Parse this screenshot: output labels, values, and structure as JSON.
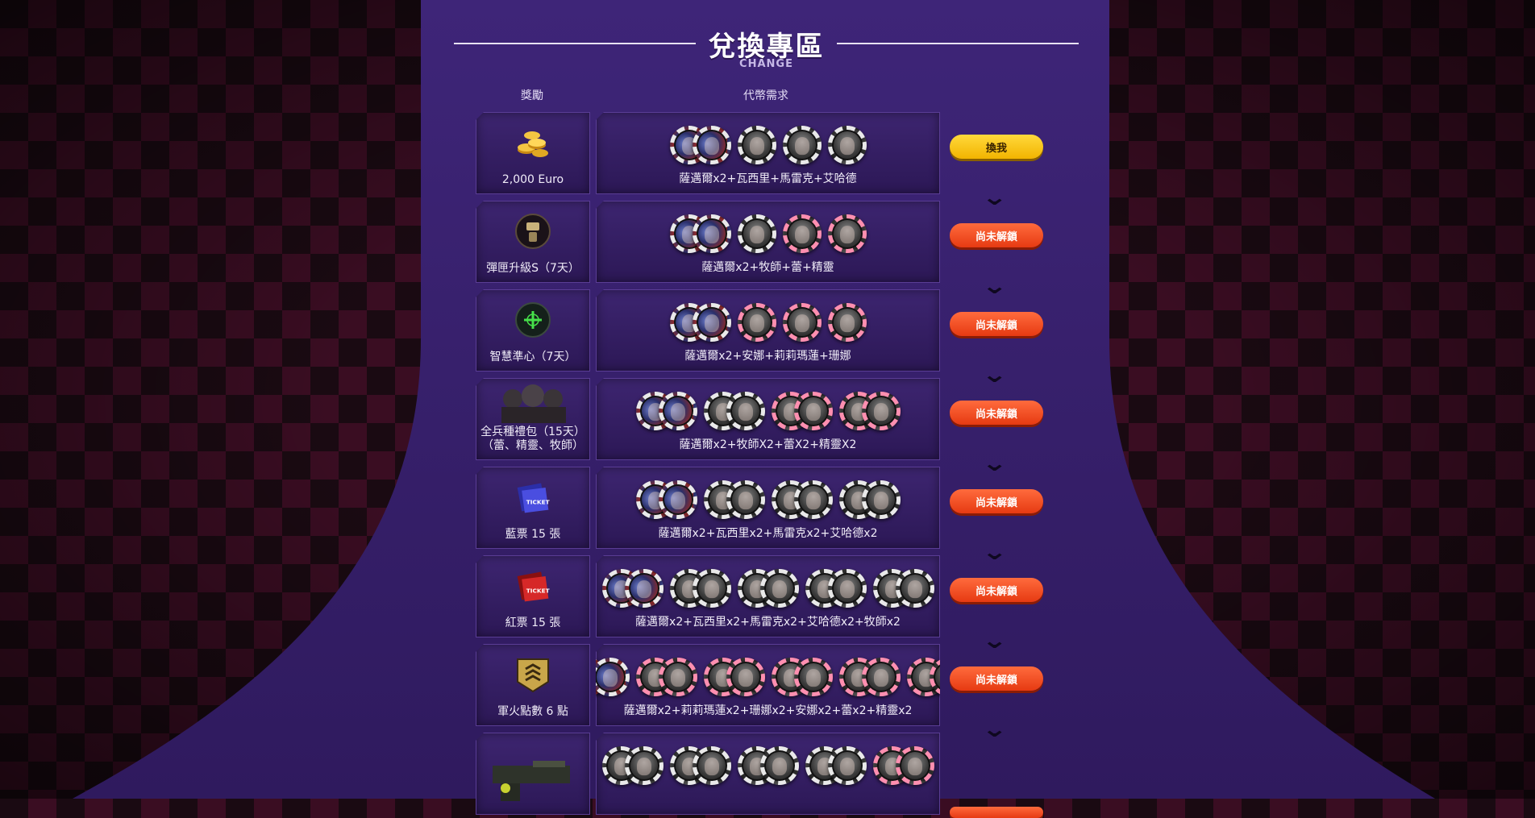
{
  "page": {
    "title": "兌換專區",
    "subtitle": "CHANGE",
    "col_reward": "獎勵",
    "col_tokens": "代幣需求"
  },
  "colors": {
    "stage": "#3a2272",
    "button_active": "#f2b400",
    "button_locked": "#e63a12"
  },
  "rows": [
    {
      "reward_icon": "gold-coins-icon",
      "reward_label": "2,000 Euro",
      "token_groups": [
        {
          "count": 2,
          "style": "blue"
        },
        {
          "count": 1,
          "style": "grey"
        },
        {
          "count": 1,
          "style": "grey"
        },
        {
          "count": 1,
          "style": "grey"
        }
      ],
      "tokens_label": "薩邁爾x2+瓦西里+馬雷克+艾哈德",
      "button": "換我",
      "button_state": "active"
    },
    {
      "reward_icon": "ammo-upgrade-icon",
      "reward_label": "彈匣升級S（7天）",
      "token_groups": [
        {
          "count": 2,
          "style": "blue"
        },
        {
          "count": 1,
          "style": "grey"
        },
        {
          "count": 1,
          "style": "pink"
        },
        {
          "count": 1,
          "style": "pink"
        }
      ],
      "tokens_label": "薩邁爾x2+牧師+蕾+精靈",
      "button": "尚未解鎖",
      "button_state": "locked"
    },
    {
      "reward_icon": "crosshair-icon",
      "reward_label": "智慧準心（7天）",
      "token_groups": [
        {
          "count": 2,
          "style": "blue"
        },
        {
          "count": 1,
          "style": "pink"
        },
        {
          "count": 1,
          "style": "pink"
        },
        {
          "count": 1,
          "style": "pink"
        }
      ],
      "tokens_label": "薩邁爾x2+安娜+莉莉瑪蓮+珊娜",
      "button": "尚未解鎖",
      "button_state": "locked"
    },
    {
      "reward_icon": "soldier-pack-icon",
      "reward_label": "全兵種禮包（15天）",
      "reward_label2": "（蕾、精靈、牧師）",
      "token_groups": [
        {
          "count": 2,
          "style": "blue"
        },
        {
          "count": 2,
          "style": "grey"
        },
        {
          "count": 2,
          "style": "pink"
        },
        {
          "count": 2,
          "style": "pink"
        }
      ],
      "tokens_label": "薩邁爾x2+牧師X2+蕾X2+精靈X2",
      "button": "尚未解鎖",
      "button_state": "locked"
    },
    {
      "reward_icon": "blue-ticket-icon",
      "reward_label": "藍票 15 張",
      "token_groups": [
        {
          "count": 2,
          "style": "blue"
        },
        {
          "count": 2,
          "style": "grey"
        },
        {
          "count": 2,
          "style": "grey"
        },
        {
          "count": 2,
          "style": "grey"
        }
      ],
      "tokens_label": "薩邁爾x2+瓦西里x2+馬雷克x2+艾哈德x2",
      "button": "尚未解鎖",
      "button_state": "locked"
    },
    {
      "reward_icon": "red-ticket-icon",
      "reward_label": "紅票 15 張",
      "token_groups": [
        {
          "count": 2,
          "style": "blue"
        },
        {
          "count": 2,
          "style": "grey"
        },
        {
          "count": 2,
          "style": "grey"
        },
        {
          "count": 2,
          "style": "grey"
        },
        {
          "count": 2,
          "style": "grey"
        }
      ],
      "tokens_label": "薩邁爾x2+瓦西里x2+馬雷克x2+艾哈德x2+牧師x2",
      "button": "尚未解鎖",
      "button_state": "locked"
    },
    {
      "reward_icon": "rank-points-icon",
      "reward_label": "軍火點數 6 點",
      "token_groups": [
        {
          "count": 2,
          "style": "blue"
        },
        {
          "count": 2,
          "style": "pink"
        },
        {
          "count": 2,
          "style": "pink"
        },
        {
          "count": 2,
          "style": "pink"
        },
        {
          "count": 2,
          "style": "pink"
        },
        {
          "count": 2,
          "style": "pink"
        }
      ],
      "tokens_label": "薩邁爾x2+莉莉瑪蓮x2+珊娜x2+安娜x2+蕾x2+精靈x2",
      "button": "尚未解鎖",
      "button_state": "locked"
    },
    {
      "reward_icon": "weapon-icon",
      "reward_label": "",
      "token_groups": [
        {
          "count": 2,
          "style": "grey"
        },
        {
          "count": 2,
          "style": "grey"
        },
        {
          "count": 2,
          "style": "grey"
        },
        {
          "count": 2,
          "style": "grey"
        },
        {
          "count": 2,
          "style": "pink"
        }
      ],
      "tokens_label": "",
      "button": "",
      "button_state": "locked"
    }
  ]
}
